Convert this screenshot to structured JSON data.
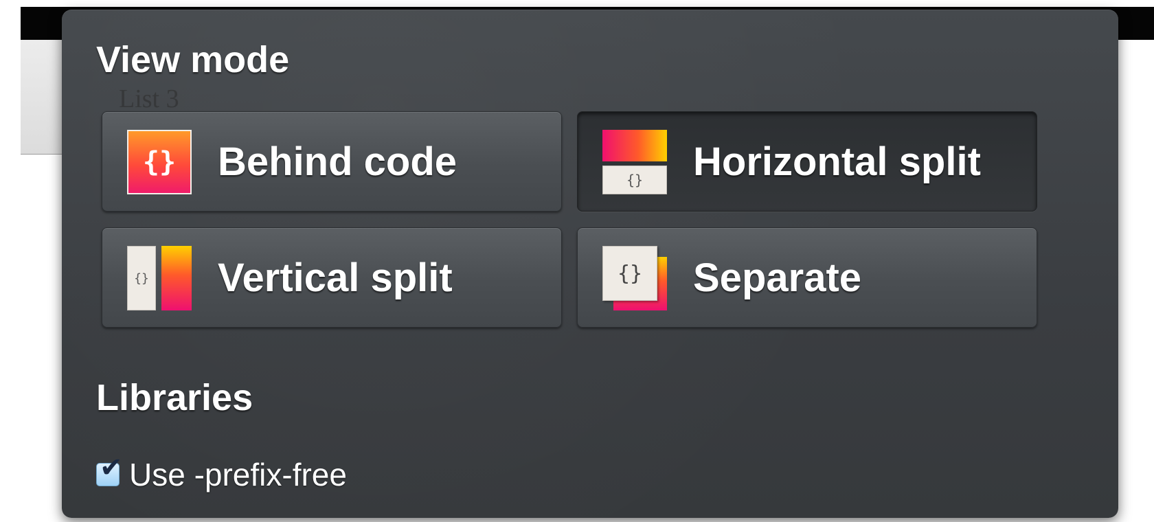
{
  "background_page": {
    "list_text": "List 3"
  },
  "settings_popup": {
    "view_mode": {
      "title": "View mode",
      "selected": "horizontal",
      "options": [
        {
          "id": "behind",
          "label": "Behind code",
          "icon": "behind-code-icon",
          "selected": false
        },
        {
          "id": "horizontal",
          "label": "Horizontal split",
          "icon": "horizontal-split-icon",
          "selected": true
        },
        {
          "id": "vertical",
          "label": "Vertical split",
          "icon": "vertical-split-icon",
          "selected": false
        },
        {
          "id": "separate",
          "label": "Separate",
          "icon": "separate-icon",
          "selected": false
        }
      ],
      "icon_glyph": "{}"
    },
    "libraries": {
      "title": "Libraries",
      "items": [
        {
          "label": "Use -prefix-free",
          "checked": true
        }
      ]
    }
  },
  "colors": {
    "popup_bg": "#3e4245",
    "button_bg": "#4f5357",
    "selected_button_bg": "#303336",
    "accent_gradient_start": "#ffd000",
    "accent_gradient_mid": "#ff5a2a",
    "accent_gradient_end": "#ee1070",
    "checkbox_fill": "#b7defa"
  }
}
